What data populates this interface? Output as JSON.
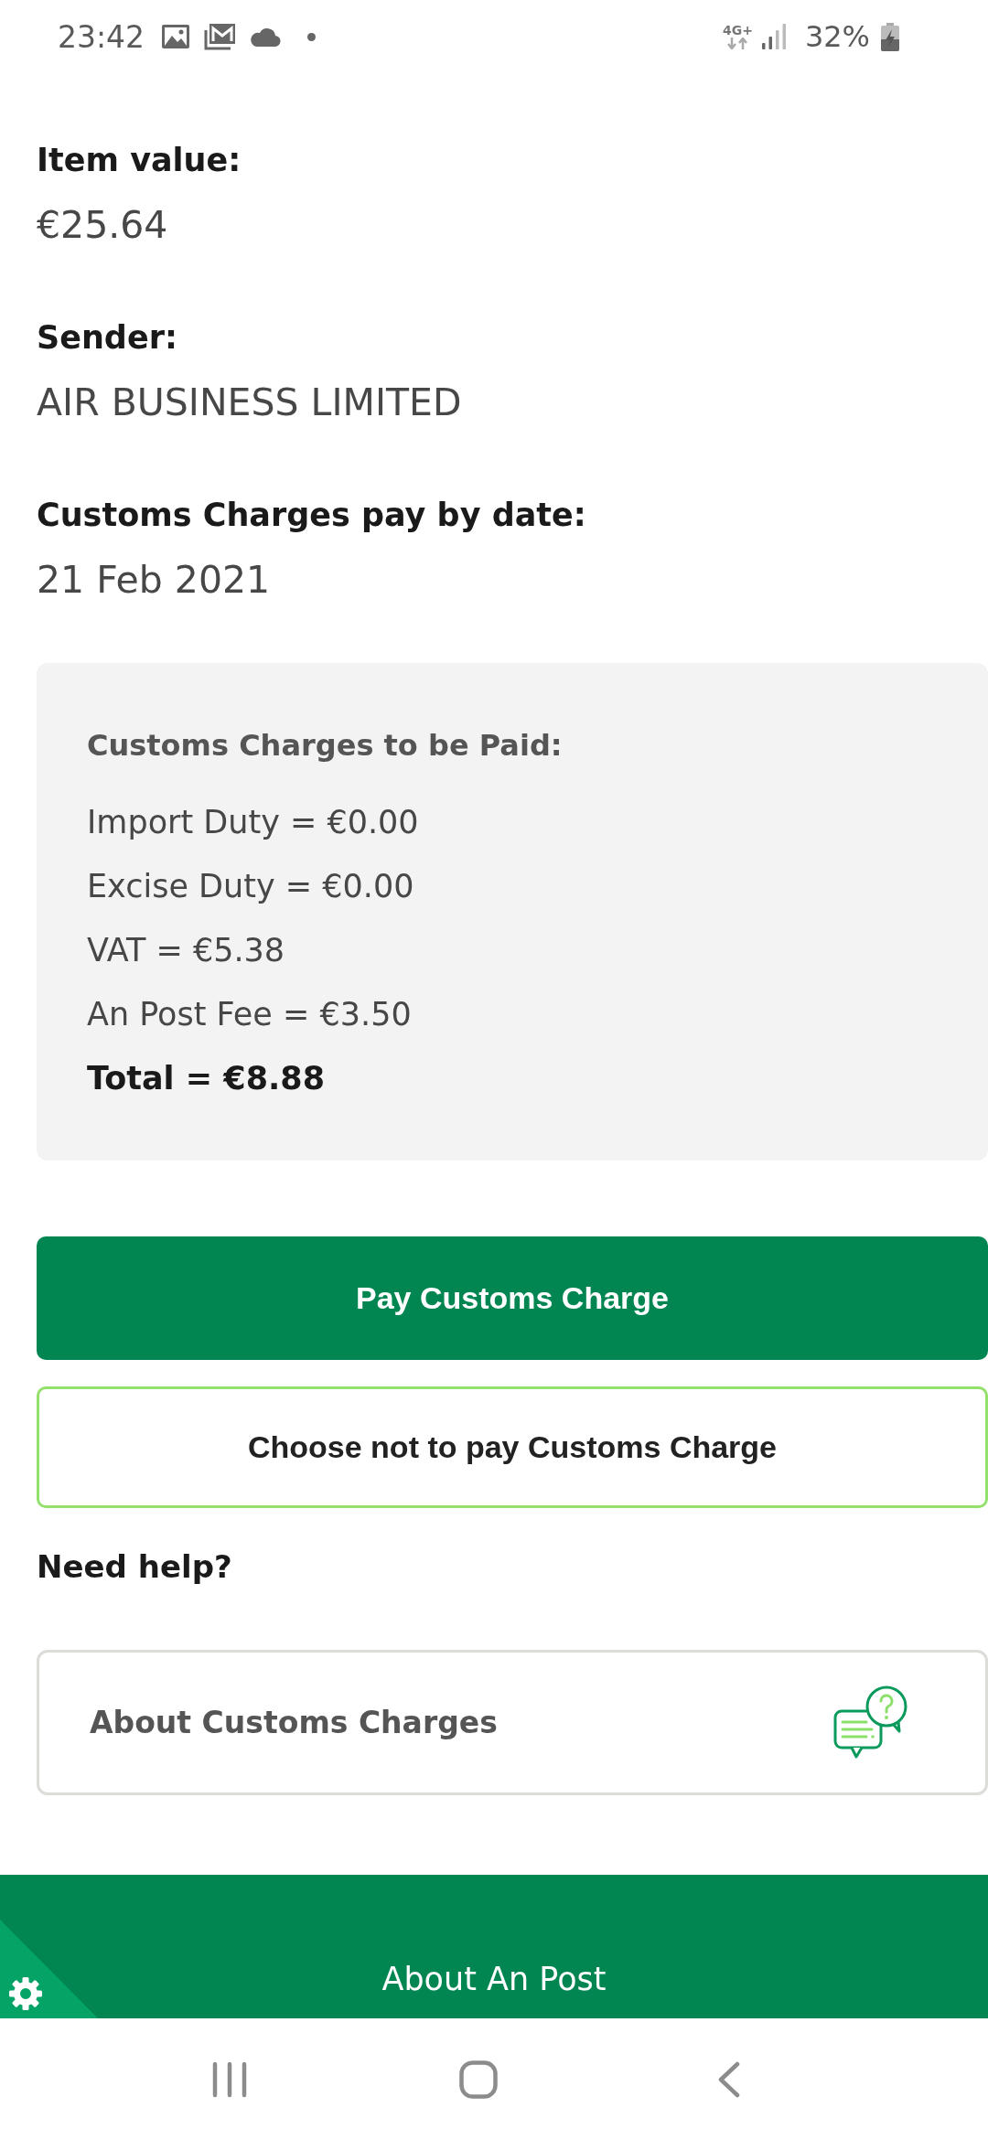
{
  "status_bar": {
    "time": "23:42",
    "network": "4G+",
    "battery": "32%"
  },
  "details": [
    {
      "label": "Item value:",
      "value": "€25.64"
    },
    {
      "label": "Sender:",
      "value": "AIR BUSINESS LIMITED"
    },
    {
      "label": "Customs Charges pay by date:",
      "value": "21 Feb 2021"
    }
  ],
  "charges": {
    "title": "Customs Charges to be Paid:",
    "lines": [
      {
        "kind": "item",
        "text": "Import Duty = €0.00"
      },
      {
        "kind": "item",
        "text": "Excise Duty = €0.00"
      },
      {
        "kind": "item",
        "text": "VAT = €5.38"
      },
      {
        "kind": "item",
        "text": "An Post Fee = €3.50"
      },
      {
        "kind": "total",
        "text": "Total = €8.88"
      }
    ]
  },
  "buttons": [
    {
      "kind": "primary",
      "label": "Pay Customs Charge"
    },
    {
      "kind": "secondary",
      "label": "Choose not to pay Customs Charge"
    }
  ],
  "help": {
    "title": "Need help?",
    "cards": [
      {
        "label": "About Customs Charges"
      }
    ]
  },
  "footer": {
    "link": "About An Post"
  }
}
